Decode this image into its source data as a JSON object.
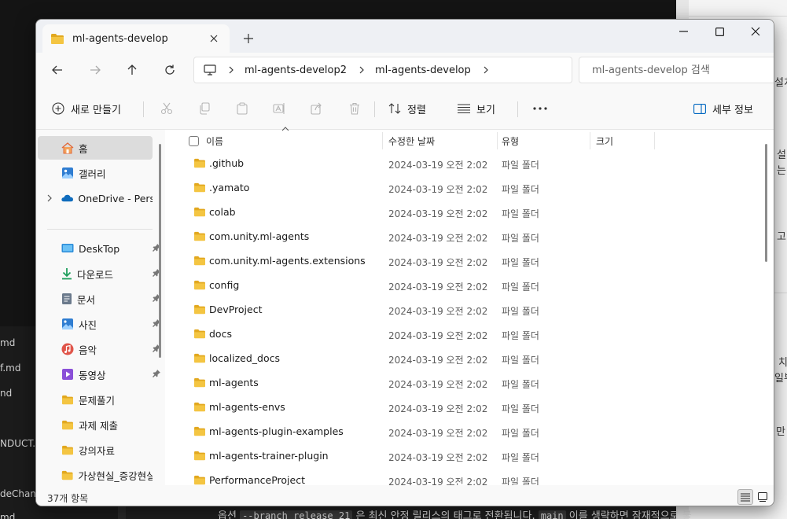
{
  "background": {
    "explorer_files": [
      "md",
      "f.md",
      "nd",
      "NDUCT.r",
      "deChan",
      "md"
    ],
    "right_fragments": [
      "설치",
      "설치",
      "는",
      "고",
      "치",
      "일부",
      "만"
    ],
    "bottom_text": {
      "prefix": "옵션",
      "code1": "--branch release_21",
      "middle": "은 최신 안정 릴리스의 태그로 전환됩니다.",
      "code2": "main",
      "suffix": "이를 생략하면 잠재적으로 불"
    }
  },
  "window": {
    "tab_title": "ml-agents-develop",
    "address": {
      "crumbs": [
        "ml-agents-develop2",
        "ml-agents-develop"
      ]
    },
    "search_placeholder": "ml-agents-develop 검색",
    "toolbar": {
      "new_label": "새로 만들기",
      "sort_label": "정렬",
      "view_label": "보기",
      "details_label": "세부 정보"
    },
    "sidebar": {
      "items": [
        {
          "label": "홈",
          "icon": "home-icon",
          "pinned": false
        },
        {
          "label": "갤러리",
          "icon": "gallery-icon",
          "pinned": false
        },
        {
          "label": "OneDrive - Persor",
          "icon": "onedrive-icon",
          "pinned": false
        },
        {
          "label": "DeskTop",
          "icon": "desktop-icon",
          "pinned": true
        },
        {
          "label": "다운로드",
          "icon": "download-icon",
          "pinned": true
        },
        {
          "label": "문서",
          "icon": "document-icon",
          "pinned": true
        },
        {
          "label": "사진",
          "icon": "pictures-icon",
          "pinned": true
        },
        {
          "label": "음악",
          "icon": "music-icon",
          "pinned": true
        },
        {
          "label": "동영상",
          "icon": "video-icon",
          "pinned": true
        },
        {
          "label": "문제풀기",
          "icon": "folder-icon",
          "pinned": false
        },
        {
          "label": "과제 제출",
          "icon": "folder-icon",
          "pinned": false
        },
        {
          "label": "강의자료",
          "icon": "folder-icon",
          "pinned": false
        },
        {
          "label": "가상현실_증강현실",
          "icon": "folder-icon",
          "pinned": false
        }
      ]
    },
    "columns": {
      "name": "이름",
      "modified": "수정한 날짜",
      "type": "유형",
      "size": "크기"
    },
    "files": [
      {
        "name": ".github",
        "date": "2024-03-19 오전 2:02",
        "type": "파일 폴더"
      },
      {
        "name": ".yamato",
        "date": "2024-03-19 오전 2:02",
        "type": "파일 폴더"
      },
      {
        "name": "colab",
        "date": "2024-03-19 오전 2:02",
        "type": "파일 폴더"
      },
      {
        "name": "com.unity.ml-agents",
        "date": "2024-03-19 오전 2:02",
        "type": "파일 폴더"
      },
      {
        "name": "com.unity.ml-agents.extensions",
        "date": "2024-03-19 오전 2:02",
        "type": "파일 폴더"
      },
      {
        "name": "config",
        "date": "2024-03-19 오전 2:02",
        "type": "파일 폴더"
      },
      {
        "name": "DevProject",
        "date": "2024-03-19 오전 2:02",
        "type": "파일 폴더"
      },
      {
        "name": "docs",
        "date": "2024-03-19 오전 2:02",
        "type": "파일 폴더"
      },
      {
        "name": "localized_docs",
        "date": "2024-03-19 오전 2:02",
        "type": "파일 폴더"
      },
      {
        "name": "ml-agents",
        "date": "2024-03-19 오전 2:02",
        "type": "파일 폴더"
      },
      {
        "name": "ml-agents-envs",
        "date": "2024-03-19 오전 2:02",
        "type": "파일 폴더"
      },
      {
        "name": "ml-agents-plugin-examples",
        "date": "2024-03-19 오전 2:02",
        "type": "파일 폴더"
      },
      {
        "name": "ml-agents-trainer-plugin",
        "date": "2024-03-19 오전 2:02",
        "type": "파일 폴더"
      },
      {
        "name": "PerformanceProject",
        "date": "2024-03-19 오전 2:02",
        "type": "파일 폴더"
      }
    ],
    "status_count": "37개 항목"
  },
  "colors": {
    "folder": "#F4C542",
    "folder_dark": "#E2A81F",
    "accent": "#0067C0"
  }
}
